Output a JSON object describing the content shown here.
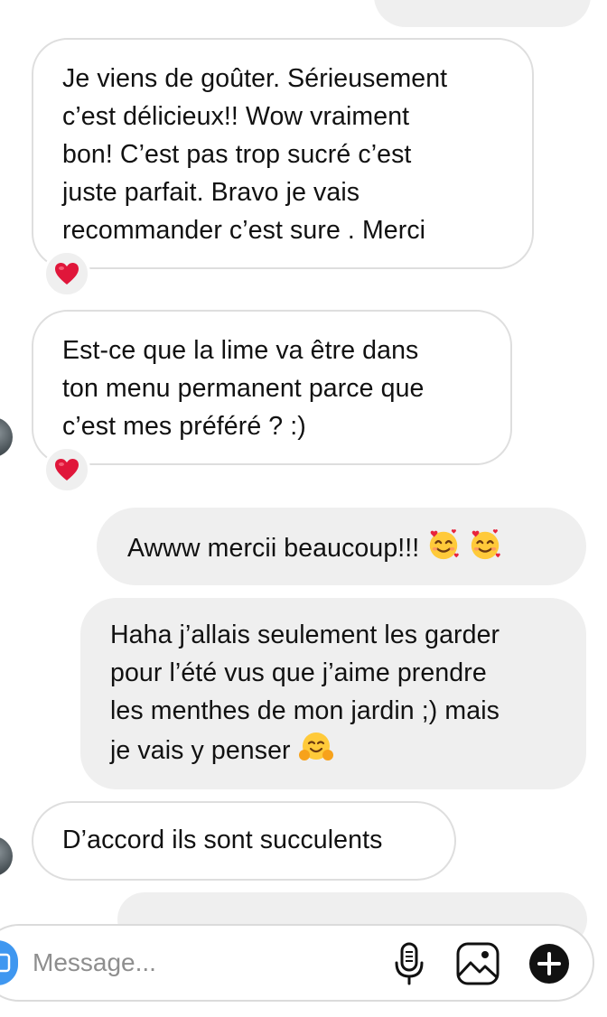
{
  "thread": {
    "messages": [
      {
        "side": "received",
        "text": "Je viens de goûter. Sérieusement\nc’est délicieux!! Wow vraiment\nbon! C’est pas trop sucré c’est\njuste parfait. Bravo je vais\nrecommander c’est sure . Merci",
        "reaction": "heart"
      },
      {
        "side": "received",
        "text": "Est-ce que la lime va être dans\nton menu permanent parce que\nc’est mes préféré ? :)",
        "reaction": "heart"
      },
      {
        "side": "sent",
        "text": "Awww mercii beaucoup!!! ",
        "emoji": [
          "smiling-face-with-hearts",
          "smiling-face-with-hearts"
        ]
      },
      {
        "side": "sent",
        "text": "Haha j’allais seulement les garder\npour l’été vus que j’aime prendre\nles menthes de mon jardin ;) mais\nje vais y penser ",
        "emoji": [
          "hugging-face"
        ]
      },
      {
        "side": "received",
        "text": "D’accord ils sont succulents"
      }
    ]
  },
  "composer": {
    "placeholder": "Message...",
    "icons": [
      "camera-icon",
      "microphone-icon",
      "gallery-icon",
      "add-icon"
    ]
  },
  "colors": {
    "sent_bubble": "#efefef",
    "received_border": "#dedede",
    "reaction_bg": "#efefef",
    "heart": "#e0163a",
    "camera_button": "#3f97f0"
  }
}
